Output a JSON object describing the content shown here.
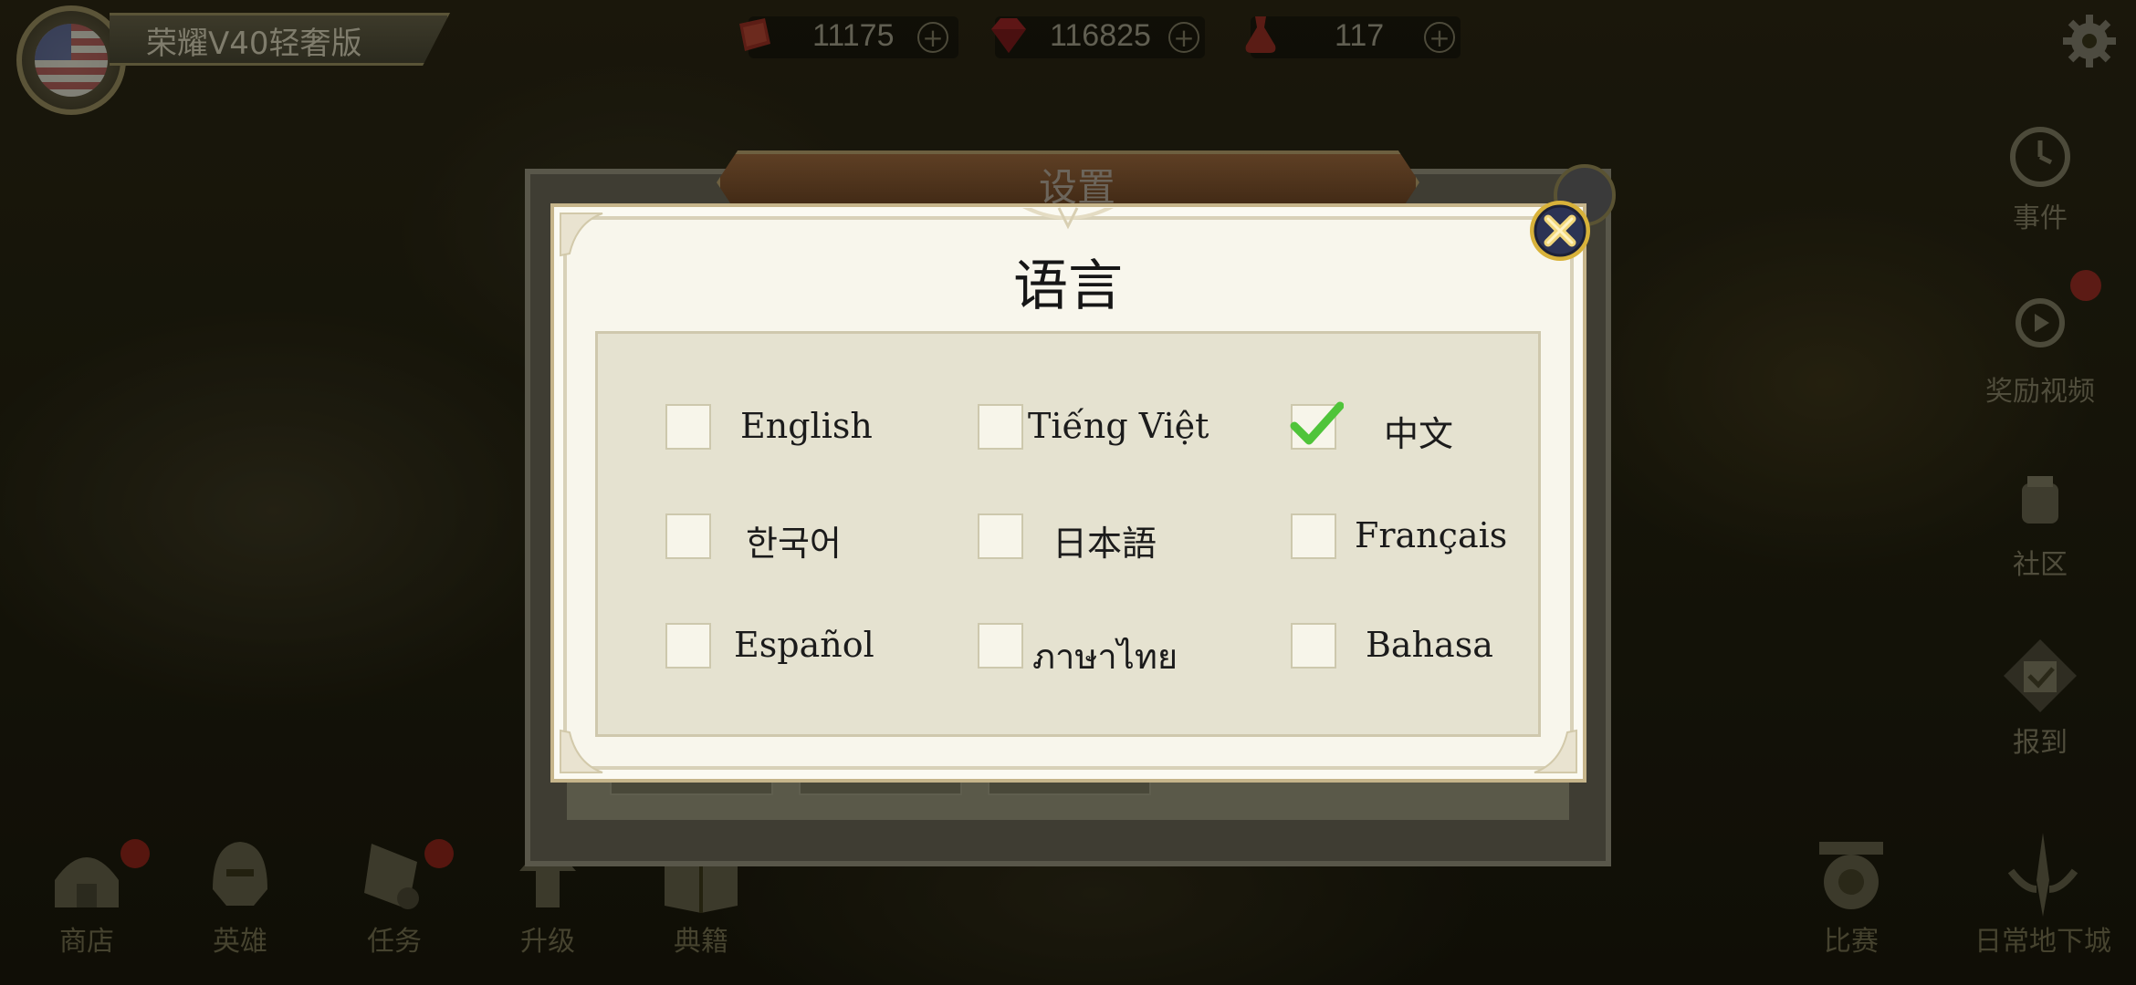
{
  "player": {
    "name": "荣耀V40轻奢版",
    "flag": "us-flag-icon"
  },
  "resources": [
    {
      "icon": "scroll-resource-icon",
      "value": "11175"
    },
    {
      "icon": "ruby-gem-icon",
      "value": "116825"
    },
    {
      "icon": "energy-potion-icon",
      "value": "117"
    }
  ],
  "sidebar": [
    {
      "icon": "clock-icon",
      "label": "事件"
    },
    {
      "icon": "video-reward-icon",
      "label": "奖励视频"
    },
    {
      "icon": "community-icon",
      "label": "社区"
    },
    {
      "icon": "checkin-icon",
      "label": "报到"
    }
  ],
  "bottom_nav": [
    {
      "icon": "shop-icon",
      "label": "商店"
    },
    {
      "icon": "hero-helmet-icon",
      "label": "英雄"
    },
    {
      "icon": "quest-scroll-icon",
      "label": "任务"
    },
    {
      "icon": "upgrade-icon",
      "label": "升级"
    },
    {
      "icon": "codex-book-icon",
      "label": "典籍"
    },
    {
      "icon": "arena-icon",
      "label": "比赛"
    },
    {
      "icon": "daily-dungeon-icon",
      "label": "日常地下城"
    }
  ],
  "settings": {
    "title": "设置"
  },
  "language_dialog": {
    "title": "语言",
    "selected": "中文",
    "options": [
      {
        "label": "English",
        "checked": false
      },
      {
        "label": "Tiếng Việt",
        "checked": false
      },
      {
        "label": "中文",
        "checked": true
      },
      {
        "label": "한국어",
        "checked": false
      },
      {
        "label": "日本語",
        "checked": false
      },
      {
        "label": "Français",
        "checked": false
      },
      {
        "label": "Español",
        "checked": false
      },
      {
        "label": "ภาษาไทย",
        "checked": false
      },
      {
        "label": "Bahasa",
        "checked": false
      }
    ]
  },
  "colors": {
    "check": "#4fc43a",
    "dialog_bg": "#f8f6ec",
    "dialog_inner": "#e5e2d0",
    "close_gold": "#d8b23a"
  }
}
